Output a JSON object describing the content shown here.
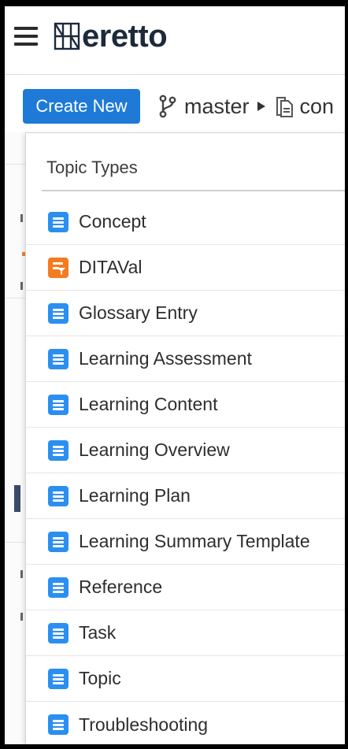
{
  "header": {
    "menu_icon": "hamburger-menu-icon",
    "logo_text": "eretto",
    "logo_icon": "heretto-grid-logo"
  },
  "toolbar": {
    "create_label": "Create New",
    "branch_icon": "git-branch-icon",
    "branch_name": "master",
    "path_icon": "folder-doc-icon",
    "path_text": "con"
  },
  "dropdown": {
    "title": "Topic Types",
    "items": [
      {
        "label": "Concept",
        "icon": "concept-doc-icon",
        "color": "#2b8ff0"
      },
      {
        "label": "DITAVal",
        "icon": "ditaval-filter-icon",
        "color": "#f47c20"
      },
      {
        "label": "Glossary Entry",
        "icon": "glossary-doc-icon",
        "color": "#2b8ff0"
      },
      {
        "label": "Learning Assessment",
        "icon": "learning-assessment-doc-icon",
        "color": "#2b8ff0"
      },
      {
        "label": "Learning Content",
        "icon": "learning-content-doc-icon",
        "color": "#2b8ff0"
      },
      {
        "label": "Learning Overview",
        "icon": "learning-overview-doc-icon",
        "color": "#2b8ff0"
      },
      {
        "label": "Learning Plan",
        "icon": "learning-plan-doc-icon",
        "color": "#2b8ff0"
      },
      {
        "label": "Learning Summary Template",
        "icon": "learning-summary-doc-icon",
        "color": "#2b8ff0"
      },
      {
        "label": "Reference",
        "icon": "reference-doc-icon",
        "color": "#2b8ff0"
      },
      {
        "label": "Task",
        "icon": "task-doc-icon",
        "color": "#2b8ff0"
      },
      {
        "label": "Topic",
        "icon": "topic-doc-icon",
        "color": "#2b8ff0"
      },
      {
        "label": "Troubleshooting",
        "icon": "troubleshooting-doc-icon",
        "color": "#2b8ff0"
      }
    ]
  },
  "colors": {
    "accent": "#1e7ad6",
    "doc_icon_blue": "#2b8ff0",
    "ditaval_orange": "#f47c20"
  }
}
